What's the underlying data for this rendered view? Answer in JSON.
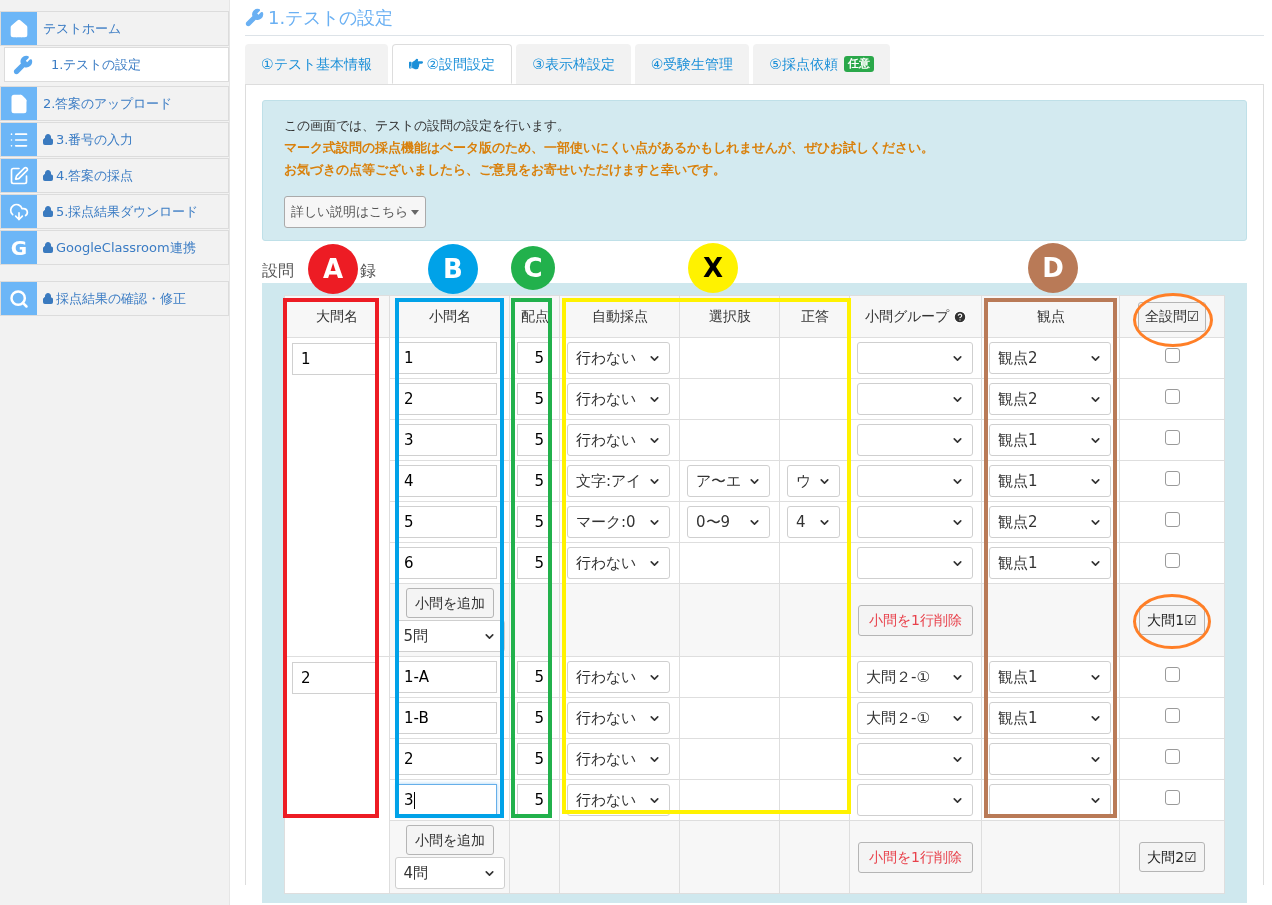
{
  "sidebar": {
    "items": [
      {
        "kind": "home",
        "label": "テストホーム",
        "locked": false,
        "selected": false
      },
      {
        "kind": "wrench",
        "label": "1.テストの設定",
        "locked": false,
        "selected": true
      },
      {
        "kind": "file",
        "label": "2.答案のアップロード",
        "locked": false,
        "selected": false
      },
      {
        "kind": "list",
        "label": "3.番号の入力",
        "locked": true,
        "selected": false
      },
      {
        "kind": "edit",
        "label": "4.答案の採点",
        "locked": true,
        "selected": false
      },
      {
        "kind": "cloud",
        "label": "5.採点結果ダウンロード",
        "locked": true,
        "selected": false
      },
      {
        "kind": "letter",
        "glyph": "G",
        "label": "GoogleClassroom連携",
        "locked": true,
        "selected": false
      }
    ],
    "bottom_items": [
      {
        "kind": "search",
        "label": "採点結果の確認・修正",
        "locked": true,
        "selected": false
      }
    ]
  },
  "page_title": "1.テストの設定",
  "tabs": [
    {
      "label": "①テスト基本情報",
      "selected": false
    },
    {
      "label": "②設問設定",
      "selected": true
    },
    {
      "label": "③表示枠設定",
      "selected": false
    },
    {
      "label": "④受験生管理",
      "selected": false
    },
    {
      "label": "⑤採点依頼",
      "badge": "任意",
      "selected": false
    }
  ],
  "info": {
    "lines": [
      {
        "text": "この画面では、テストの設問の設定を行います。",
        "emphasis": false
      },
      {
        "text": "マーク式設問の採点機能はベータ版のため、一部使いにくい点があるかもしれませんが、ぜひお試しください。",
        "emphasis": true
      },
      {
        "text": "お気づきの点等ございましたら、ご意見をお寄せいただけますと幸いです。",
        "emphasis": true
      }
    ],
    "button": "詳しい説明はこちら"
  },
  "section_heading": [
    "設問",
    "録"
  ],
  "table": {
    "columns": [
      "大問名",
      "小問名",
      "配点",
      "自動採点",
      "選択肢",
      "正答",
      "小問グループ",
      "観点",
      "全設問☑"
    ],
    "groups": [
      {
        "name": "1",
        "rows": [
          {
            "sub": "1",
            "score": "5",
            "auto": "行わない",
            "viewpoint": "観点2",
            "checked": false,
            "focused": false
          },
          {
            "sub": "2",
            "score": "5",
            "auto": "行わない",
            "viewpoint": "観点2",
            "checked": false,
            "focused": false
          },
          {
            "sub": "3",
            "score": "5",
            "auto": "行わない",
            "viewpoint": "観点1",
            "checked": false,
            "focused": false
          },
          {
            "sub": "4",
            "score": "5",
            "auto": "文字:アイ",
            "choices": "ア〜エ",
            "answer": "ウ",
            "viewpoint": "観点1",
            "checked": false,
            "focused": false
          },
          {
            "sub": "5",
            "score": "5",
            "auto": "マーク:0",
            "choices": "0〜9",
            "answer": "4",
            "viewpoint": "観点2",
            "checked": false,
            "focused": false
          },
          {
            "sub": "6",
            "score": "5",
            "auto": "行わない",
            "viewpoint": "観点1",
            "checked": false,
            "focused": false
          }
        ],
        "add_button": "小問を追加",
        "count": "5問",
        "delete_button": "小問を1行削除",
        "group_button": "大問1☑"
      },
      {
        "name": "2",
        "rows": [
          {
            "sub": "1-A",
            "score": "5",
            "auto": "行わない",
            "group": "大問２-①",
            "viewpoint": "観点1",
            "checked": false,
            "focused": false
          },
          {
            "sub": "1-B",
            "score": "5",
            "auto": "行わない",
            "group": "大問２-①",
            "viewpoint": "観点1",
            "checked": false,
            "focused": false
          },
          {
            "sub": "2",
            "score": "5",
            "auto": "行わない",
            "checked": false,
            "focused": false
          },
          {
            "sub": "3",
            "score": "5",
            "auto": "行わない",
            "checked": false,
            "focused": true
          }
        ],
        "add_button": "小問を追加",
        "count": "4問",
        "delete_button": "小問を1行削除",
        "group_button": "大問2☑"
      }
    ]
  },
  "annotations": [
    {
      "label": "A",
      "color": "#ed1c24"
    },
    {
      "label": "B",
      "color": "#00a2e8"
    },
    {
      "label": "C",
      "color": "#22b14c"
    },
    {
      "label": "X",
      "color": "#fff200"
    },
    {
      "label": "D",
      "color": "#b97a57"
    }
  ],
  "highlights": [
    {
      "color": "#ff7f27"
    },
    {
      "color": "#ff7f27"
    }
  ]
}
